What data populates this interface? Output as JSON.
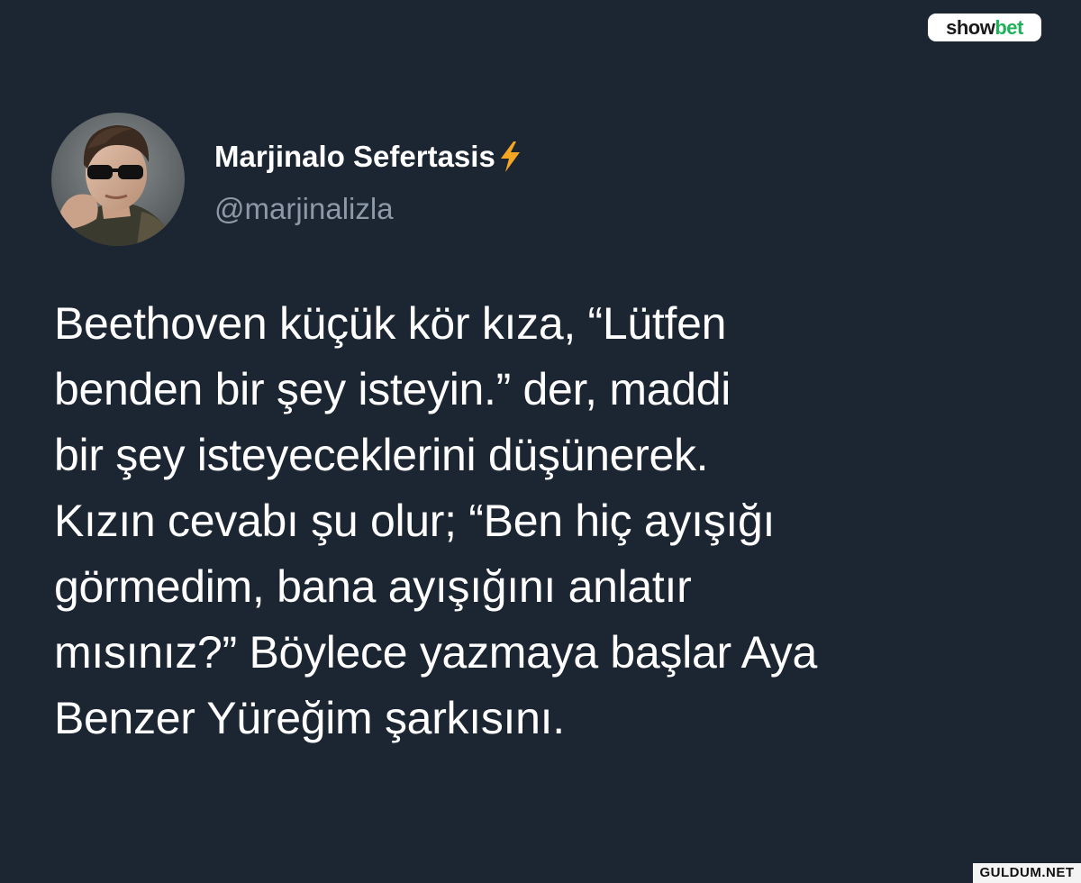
{
  "watermark": {
    "brand_part1": "show",
    "brand_part2": "bet",
    "brand_color": "#1fb05a",
    "corner_text": "GULDUM.NET"
  },
  "tweet": {
    "author": {
      "display_name": "Marjinalo Sefertasis",
      "badge_icon": "lightning-bolt-icon",
      "badge_color": "#f5a623",
      "handle": "@marjinalizla",
      "avatar_icon": "profile-photo"
    },
    "lines": [
      "Beethoven küçük kör kıza, “Lütfen",
      "benden bir şey isteyin.” der, maddi",
      "bir şey isteyeceklerini düşünerek.",
      "Kızın cevabı şu olur; “Ben hiç ayışığı",
      "görmedim, bana ayışığını anlatır",
      "mısınız?” Böylece yazmaya başlar Aya",
      "Benzer Yüreğim şarkısını."
    ]
  },
  "colors": {
    "background": "#1c2532",
    "text_primary": "#ffffff",
    "text_secondary": "#8d99a6"
  }
}
